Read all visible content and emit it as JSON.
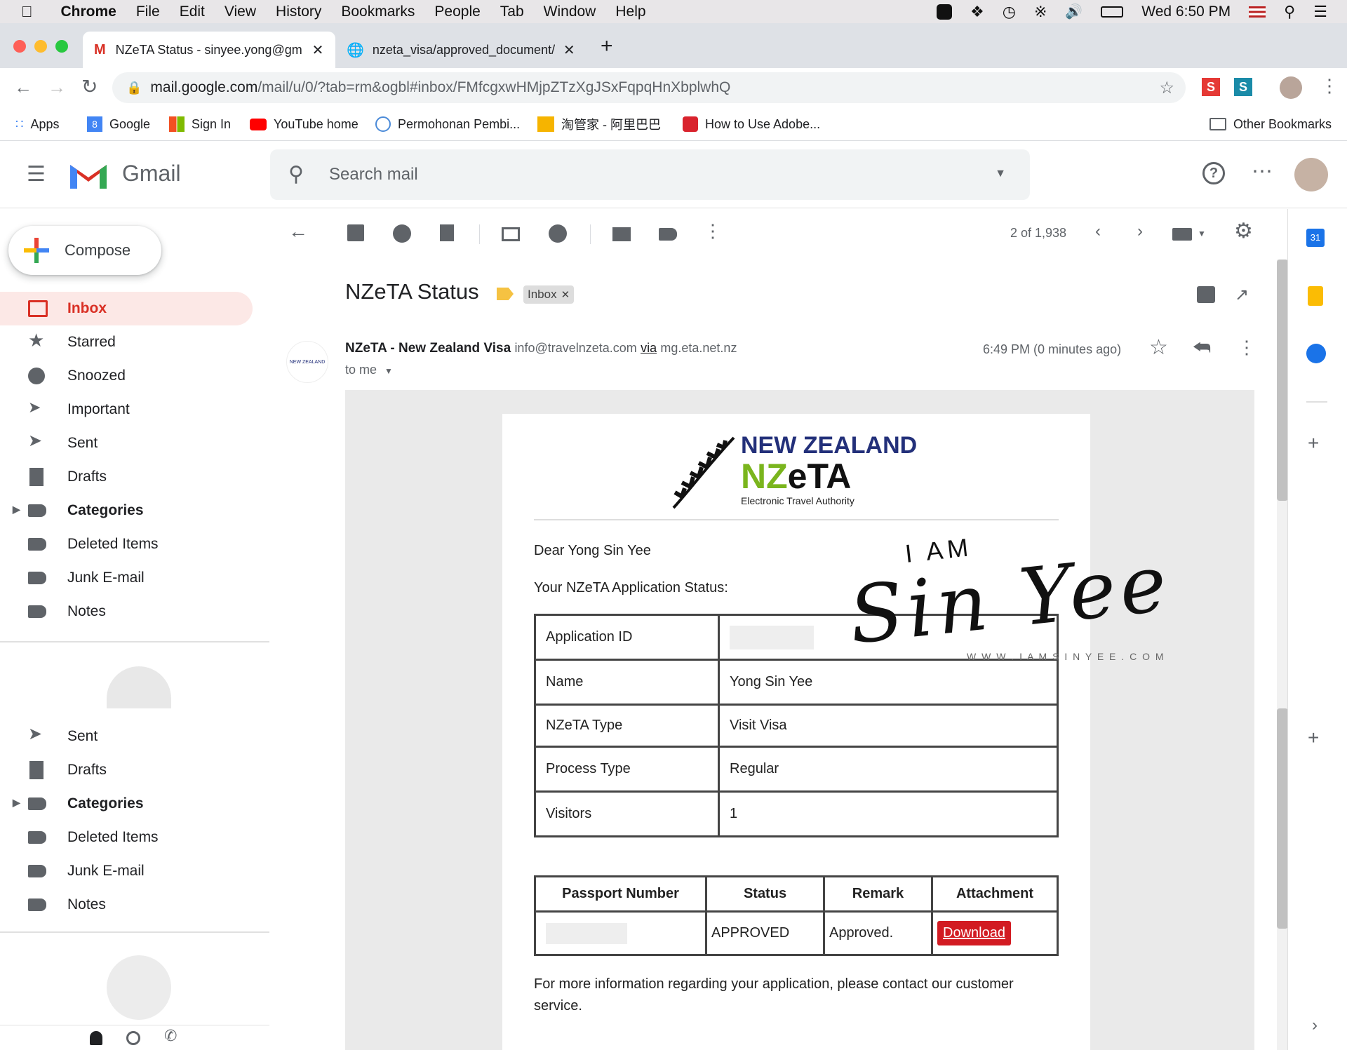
{
  "macos": {
    "app_name": "Chrome",
    "menus": [
      "File",
      "Edit",
      "View",
      "History",
      "Bookmarks",
      "People",
      "Tab",
      "Window",
      "Help"
    ],
    "clock": "Wed 6:50 PM"
  },
  "browser": {
    "tabs": [
      {
        "title": "NZeTA Status - sinyee.yong@gm",
        "active": true
      },
      {
        "title": "nzeta_visa/approved_document/",
        "active": false
      }
    ],
    "new_tab": "+",
    "url_host": "mail.google.com",
    "url_rest": "/mail/u/0/?tab=rm&ogbl#inbox/FMfcgxwHMjpZTzXgJSxFqpqHnXbplwhQ",
    "bookmarks": [
      "Apps",
      "Google",
      "Sign In",
      "YouTube home",
      "Permohonan Pembi...",
      "淘管家 - 阿里巴巴",
      "How to Use Adobe..."
    ],
    "other_bookmarks": "Other Bookmarks"
  },
  "gmail": {
    "logo_text": "Gmail",
    "search_placeholder": "Search mail",
    "compose": "Compose",
    "nav_top": [
      {
        "label": "Inbox",
        "icon": "inbox-icon",
        "active": true
      },
      {
        "label": "Starred",
        "icon": "star-icon"
      },
      {
        "label": "Snoozed",
        "icon": "clock-icon"
      },
      {
        "label": "Important",
        "icon": "important-icon"
      },
      {
        "label": "Sent",
        "icon": "send-icon"
      },
      {
        "label": "Drafts",
        "icon": "draft-icon"
      },
      {
        "label": "Categories",
        "icon": "label-icon",
        "bold": true
      },
      {
        "label": "Deleted Items",
        "icon": "label-icon"
      },
      {
        "label": "Junk E-mail",
        "icon": "label-icon"
      },
      {
        "label": "Notes",
        "icon": "label-icon"
      }
    ],
    "nav_bottom": [
      {
        "label": "Sent",
        "icon": "send-icon"
      },
      {
        "label": "Drafts",
        "icon": "draft-icon"
      },
      {
        "label": "Categories",
        "icon": "label-icon",
        "bold": true
      },
      {
        "label": "Deleted Items",
        "icon": "label-icon"
      },
      {
        "label": "Junk E-mail",
        "icon": "label-icon"
      },
      {
        "label": "Notes",
        "icon": "label-icon"
      }
    ],
    "pagination": "2 of 1,938"
  },
  "email": {
    "subject": "NZeTA Status",
    "label_chip": "Inbox",
    "sender_name": "NZeTA - New Zealand Visa",
    "sender_email": "info@travelnzeta.com",
    "via": "via",
    "via_domain": "mg.eta.net.nz",
    "to": "to me",
    "time": "6:49 PM (0 minutes ago)",
    "sender_avatar_text": "NEW ZEALAND",
    "brand": {
      "line1": "NEW ZEALAND",
      "line2a": "NZ",
      "line2b": "eTA",
      "line3": "Electronic Travel Authority"
    },
    "greeting": "Dear Yong Sin Yee",
    "status_heading": "Your NZeTA Application Status:",
    "details": [
      {
        "label": "Application ID",
        "value": ""
      },
      {
        "label": "Name",
        "value": "Yong Sin Yee"
      },
      {
        "label": "NZeTA Type",
        "value": "Visit Visa"
      },
      {
        "label": "Process Type",
        "value": "Regular"
      },
      {
        "label": "Visitors",
        "value": "1"
      }
    ],
    "status_table": {
      "headers": [
        "Passport Number",
        "Status",
        "Remark",
        "Attachment"
      ],
      "row": {
        "passport": "",
        "status": "APPROVED",
        "remark": "Approved.",
        "attachment": "Download"
      }
    },
    "footer": "For more information regarding your application, please contact our customer service."
  },
  "watermark": {
    "line1": "I AM",
    "line2": "Sin Yee",
    "line3": "W W W . I A M S I N Y E E . C O M"
  },
  "colors": {
    "gmail_red": "#d93025",
    "download_red": "#d21b22",
    "nz_navy": "#23307a",
    "nz_green": "#7ab51d"
  }
}
